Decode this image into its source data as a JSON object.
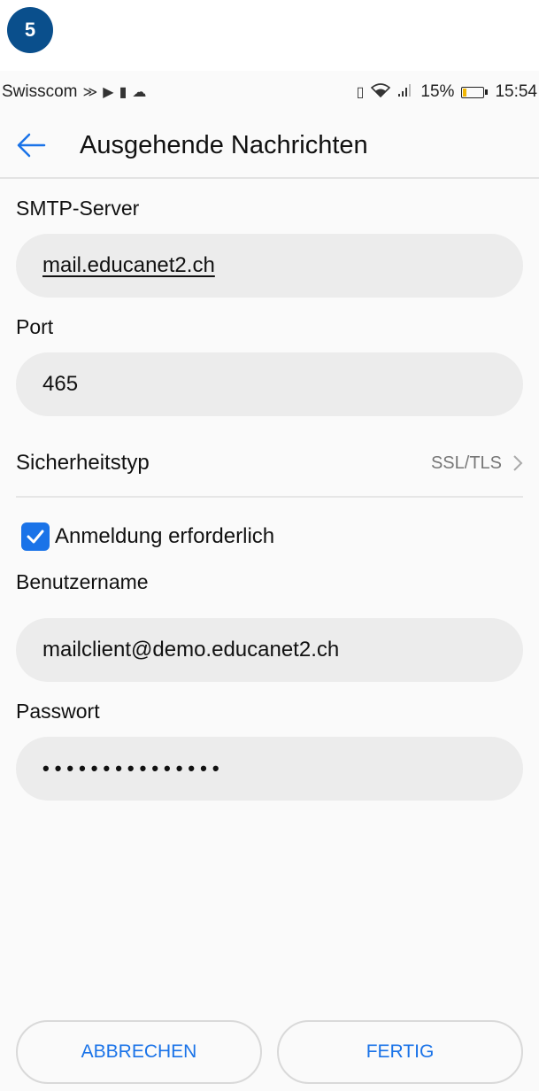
{
  "step": "5",
  "status_bar": {
    "carrier": "Swisscom",
    "battery": "15%",
    "time": "15:54",
    "battery_level": 0.15
  },
  "app_bar": {
    "title": "Ausgehende Nachrichten"
  },
  "form": {
    "smtp_label": "SMTP-Server",
    "smtp_value": "mail.educanet2.ch",
    "port_label": "Port",
    "port_value": "465",
    "security_label": "Sicherheitstyp",
    "security_value": "SSL/TLS",
    "auth_label": "Anmeldung erforderlich",
    "auth_checked": true,
    "username_label": "Benutzername",
    "username_value": "mailclient@demo.educanet2.ch",
    "password_label": "Passwort",
    "password_value": "•••••••••••••••"
  },
  "buttons": {
    "cancel": "ABBRECHEN",
    "done": "FERTIG"
  },
  "colors": {
    "accent": "#1a73e8",
    "badge": "#0a4f8c",
    "field_bg": "#ececec"
  }
}
